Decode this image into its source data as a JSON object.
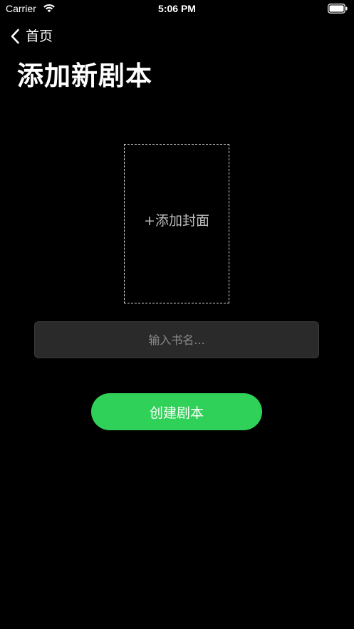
{
  "status_bar": {
    "carrier": "Carrier",
    "time": "5:06 PM",
    "wifi_icon": "wifi-icon",
    "battery_icon": "battery-icon"
  },
  "nav": {
    "back_label": "首页",
    "back_icon": "chevron-left-icon"
  },
  "page": {
    "title": "添加新剧本"
  },
  "cover": {
    "label": "+添加封面"
  },
  "form": {
    "title_value": "",
    "title_placeholder": "输入书名..."
  },
  "actions": {
    "create_label": "创建剧本"
  },
  "colors": {
    "background": "#000000",
    "accent": "#30d158",
    "input_bg": "#2a2a2b"
  }
}
